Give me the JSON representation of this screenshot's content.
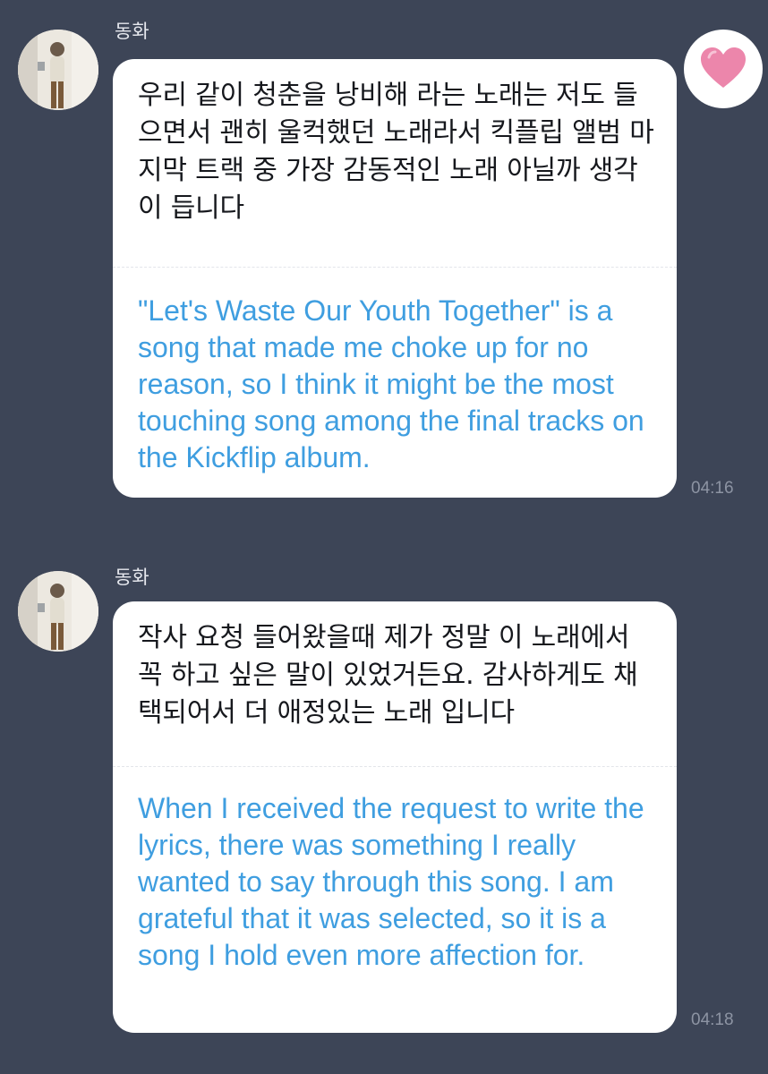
{
  "messages": [
    {
      "sender": "동화",
      "original_text": "우리 같이 청춘을 낭비해 라는 노래는 저도 들으면서 괜히 울컥했던 노래라서 킥플립 앨범 마지막 트랙 중 가장 감동적인 노래 아닐까 생각이 듭니다",
      "translation": "\"Let's Waste Our Youth Together\" is a song that made me choke up for no reason, so I think it might be the most touching song among the final tracks on the Kickflip album.",
      "time": "04:16",
      "reaction": "heart-icon"
    },
    {
      "sender": "동화",
      "original_text": "작사 요청 들어왔을때 제가 정말 이 노래에서 꼭 하고 싶은 말이 있었거든요. 감사하게도 채택되어서 더 애정있는 노래 입니다",
      "translation": "When I received the request to write the lyrics, there was something I really wanted to say through this song. I am grateful that it was selected, so it is a song I hold even more affection for.",
      "time": "04:18"
    }
  ],
  "colors": {
    "background": "#3d4557",
    "bubble": "#ffffff",
    "translation_text": "#3f9ee0",
    "timestamp": "#8d94a3",
    "heart": "#ec86ab"
  }
}
